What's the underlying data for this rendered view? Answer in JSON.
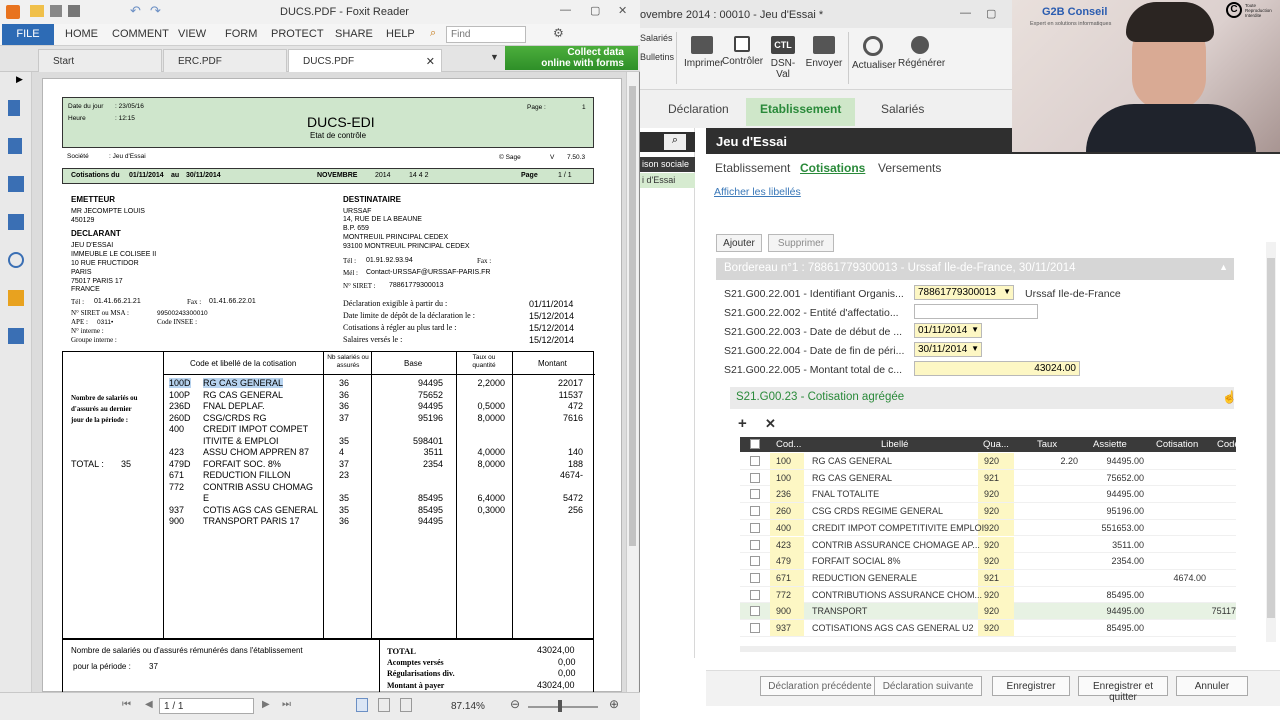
{
  "foxit": {
    "title": "DUCS.PDF - Foxit Reader",
    "file_label": "FILE",
    "menus": [
      "HOME",
      "COMMENT",
      "VIEW",
      "FORM",
      "PROTECT",
      "SHARE",
      "HELP"
    ],
    "find_placeholder": "Find",
    "tabs": [
      "Start",
      "ERC.PDF",
      "DUCS.PDF"
    ],
    "collect_banner": [
      "Collect data",
      "online with forms"
    ],
    "status": {
      "page": "1 / 1",
      "zoom": "87.14%"
    }
  },
  "doc": {
    "date_label": "Date du jour",
    "date_value": ": 23/05/16",
    "heure_label": "Heure",
    "heure_value": ": 12:15",
    "page_label": "Page :",
    "page_value": "1",
    "title": "DUCS-EDI",
    "subtitle": "Etat de contrôle",
    "societe_label": "Société",
    "societe_value": ": Jeu d'Essai",
    "sage": "© Sage",
    "version_label": "V",
    "version_value": "7.50.3",
    "period_bar": {
      "label": "Cotisations du",
      "from": "01/11/2014",
      "au": "au",
      "to": "30/11/2014",
      "month": "NOVEMBRE",
      "year": "2014",
      "code": "14 4 2",
      "page_label": "Page",
      "page": "1 / 1"
    },
    "emetteur": {
      "heading": "EMETTEUR",
      "name": "MR JECOMPTE LOUIS",
      "code": "450129"
    },
    "declarant": {
      "heading": "DECLARANT",
      "lines": [
        "JEU D'ESSAI",
        "IMMEUBLE LE COLISEE II",
        "10 RUE FRUCTIDOR",
        "PARIS",
        "75017  PARIS 17",
        "FRANCE"
      ]
    },
    "decl_contacts": {
      "tel_label": "Tél :",
      "tel": "01.41.66.21.21",
      "fax_label": "Fax :",
      "fax": "01.41.66.22.01",
      "siret_label": "N° SIRET ou MSA :",
      "siret": "99500243300010",
      "ape_label": "APE :",
      "ape": "0311•",
      "insee_label": "Code INSEE :",
      "interne_label": "N° interne :",
      "groupe_label": "Groupe interne :"
    },
    "destinataire": {
      "heading": "DESTINATAIRE",
      "lines": [
        "URSSAF",
        "14, RUE DE LA BEAUNE",
        "B.P. 659",
        "MONTREUIL PRINCIPAL CEDEX",
        "93100  MONTREUIL PRINCIPAL CEDEX"
      ],
      "tel_label": "Tél :",
      "tel": "01.91.92.93.94",
      "fax_label": "Fax :",
      "mel_label": "Mél :",
      "mel": "Contact-URSSAF@URSSAF-PARIS.FR",
      "siret_label": "N° SIRET :",
      "siret": "78861779300013"
    },
    "dates": [
      {
        "label": "Déclaration exigible à partir du :",
        "value": "01/11/2014"
      },
      {
        "label": "Date limite de dépôt de la déclaration le :",
        "value": "15/12/2014"
      },
      {
        "label": "Cotisations à régler au plus tard le :",
        "value": "15/12/2014"
      },
      {
        "label": "Salaires versés le :",
        "value": "15/12/2014"
      }
    ],
    "table_headers": {
      "code": "Code et libellé de la cotisation",
      "nb": "Nb salariés ou assurés",
      "base": "Base",
      "taux": "Taux ou quantité",
      "montant": "Montant"
    },
    "nb_label": [
      "Nombre de salariés ou",
      "d'assurés au dernier",
      "jour de la période :"
    ],
    "total_label": "TOTAL :",
    "total_value": "35",
    "rows": [
      {
        "code": "100D",
        "lib": "RG CAS GENERAL",
        "nb": "36",
        "base": "94495",
        "taux": "2,2000",
        "mont": "22017"
      },
      {
        "code": "100P",
        "lib": "RG CAS GENERAL",
        "nb": "36",
        "base": "75652",
        "taux": "",
        "mont": "11537"
      },
      {
        "code": "236D",
        "lib": "FNAL DEPLAF.",
        "nb": "36",
        "base": "94495",
        "taux": "0,5000",
        "mont": "472"
      },
      {
        "code": "260D",
        "lib": "CSG/CRDS RG",
        "nb": "37",
        "base": "95196",
        "taux": "8,0000",
        "mont": "7616"
      },
      {
        "code": "400",
        "lib": "CREDIT IMPOT COMPET",
        "nb": "",
        "base": "",
        "taux": "",
        "mont": ""
      },
      {
        "code": "",
        "lib": "ITIVITE & EMPLOI",
        "nb": "35",
        "base": "598401",
        "taux": "",
        "mont": ""
      },
      {
        "code": "423",
        "lib": "ASSU CHOM APPREN 87",
        "nb": "4",
        "base": "3511",
        "taux": "4,0000",
        "mont": "140"
      },
      {
        "code": "479D",
        "lib": "FORFAIT SOC. 8%",
        "nb": "37",
        "base": "2354",
        "taux": "8,0000",
        "mont": "188"
      },
      {
        "code": "671",
        "lib": "REDUCTION FILLON",
        "nb": "23",
        "base": "",
        "taux": "",
        "mont": "4674-"
      },
      {
        "code": "772",
        "lib": "CONTRIB ASSU CHOMAG",
        "nb": "",
        "base": "",
        "taux": "",
        "mont": ""
      },
      {
        "code": "",
        "lib": "E",
        "nb": "35",
        "base": "85495",
        "taux": "6,4000",
        "mont": "5472"
      },
      {
        "code": "937",
        "lib": "COTIS AGS CAS GENERAL",
        "nb": "35",
        "base": "85495",
        "taux": "0,3000",
        "mont": "256"
      },
      {
        "code": "900",
        "lib": "TRANSPORT PARIS 17",
        "nb": "36",
        "base": "94495",
        "taux": "",
        "mont": ""
      }
    ],
    "footer": {
      "nb_label": "Nombre de salariés ou d'assurés rémunérés dans l'établissement",
      "periode_label": "pour la période :",
      "periode_value": "37",
      "totals": [
        {
          "label": "TOTAL",
          "value": "43024,00"
        },
        {
          "label": "Acomptes versés",
          "value": "0,00"
        },
        {
          "label": "Régularisations div.",
          "value": "0,00"
        },
        {
          "label": "Montant à payer",
          "value": "43024,00"
        }
      ]
    }
  },
  "app": {
    "title": "ovembre 2014 : 00010 - Jeu d'Essai *",
    "left_menu": [
      "Salariés",
      "Bulletins"
    ],
    "toolbar": [
      "Imprimer",
      "Contrôler",
      "DSN-Val",
      "Envoyer",
      "Actualiser",
      "Régénérer"
    ],
    "toolbar_icon_text": "CTL",
    "nav_tabs": [
      "Déclaration",
      "Etablissement",
      "Salariés"
    ],
    "left_items": [
      "ison sociale",
      "i d'Essai"
    ],
    "panel_title": "Jeu d'Essai",
    "content_tabs": [
      "Etablissement",
      "Cotisations",
      "Versements"
    ],
    "afficher_link": "Afficher les libellés",
    "ajouter": "Ajouter",
    "supprimer": "Supprimer",
    "bordereau": "Bordereau n°1 : 78861779300013 - Urssaf Ile-de-France, 30/11/2014",
    "fields": [
      {
        "label": "S21.G00.22.001 - Identifiant Organis...",
        "value": "78861779300013",
        "extra": "Urssaf Ile-de-France"
      },
      {
        "label": "S21.G00.22.002 - Entité d'affectatio...",
        "value": ""
      },
      {
        "label": "S21.G00.22.003 - Date de début de ...",
        "value": "01/11/2014"
      },
      {
        "label": "S21.G00.22.004 - Date de fin de péri...",
        "value": "30/11/2014"
      },
      {
        "label": "S21.G00.22.005 - Montant total de c...",
        "value": "43024.00"
      }
    ],
    "subsection": "S21.G00.23 - Cotisation agrégée",
    "grid_headers": [
      "Cod...",
      "Libellé",
      "Qua...",
      "Taux",
      "Assiette",
      "Cotisation",
      "Code"
    ],
    "grid_rows": [
      {
        "code": "100",
        "lib": "RG CAS GENERAL",
        "qua": "920",
        "taux": "2.20",
        "assiette": "94495.00",
        "cotis": ""
      },
      {
        "code": "100",
        "lib": "RG CAS GENERAL",
        "qua": "921",
        "taux": "",
        "assiette": "75652.00",
        "cotis": ""
      },
      {
        "code": "236",
        "lib": "FNAL TOTALITE",
        "qua": "920",
        "taux": "",
        "assiette": "94495.00",
        "cotis": ""
      },
      {
        "code": "260",
        "lib": "CSG CRDS REGIME GENERAL",
        "qua": "920",
        "taux": "",
        "assiette": "95196.00",
        "cotis": ""
      },
      {
        "code": "400",
        "lib": "CREDIT IMPOT COMPETITIVITE EMPLOI",
        "qua": "920",
        "taux": "",
        "assiette": "551653.00",
        "cotis": ""
      },
      {
        "code": "423",
        "lib": "CONTRIB ASSURANCE CHOMAGE AP...",
        "qua": "920",
        "taux": "",
        "assiette": "3511.00",
        "cotis": ""
      },
      {
        "code": "479",
        "lib": "FORFAIT SOCIAL 8%",
        "qua": "920",
        "taux": "",
        "assiette": "2354.00",
        "cotis": ""
      },
      {
        "code": "671",
        "lib": "REDUCTION GENERALE",
        "qua": "921",
        "taux": "",
        "assiette": "",
        "cotis": "4674.00"
      },
      {
        "code": "772",
        "lib": "CONTRIBUTIONS ASSURANCE CHOM...",
        "qua": "920",
        "taux": "",
        "assiette": "85495.00",
        "cotis": ""
      },
      {
        "code": "900",
        "lib": "TRANSPORT",
        "qua": "920",
        "taux": "",
        "assiette": "94495.00",
        "cotis": "75117"
      },
      {
        "code": "937",
        "lib": "COTISATIONS AGS CAS GENERAL U2",
        "qua": "920",
        "taux": "",
        "assiette": "85495.00",
        "cotis": ""
      }
    ],
    "bottom_buttons": [
      "Déclaration précédente",
      "Déclaration suivante",
      "Enregistrer",
      "Enregistrer et quitter",
      "Annuler"
    ]
  },
  "cam": {
    "brand": "G2B Conseil",
    "tagline": "Expert en solutions informatiques",
    "badge": "Toute Reproduction Interdite"
  }
}
